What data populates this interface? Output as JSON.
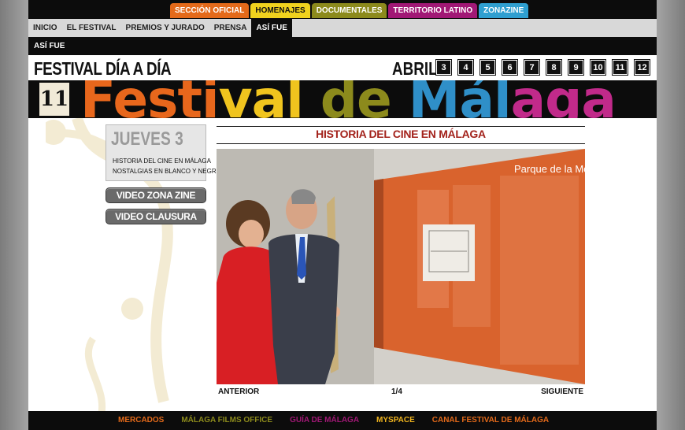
{
  "top_tabs": [
    {
      "label": "SECCIÓN OFICIAL",
      "bg": "#e46a1a",
      "fg": "#ffffff"
    },
    {
      "label": "HOMENAJES",
      "bg": "#f0d21e",
      "fg": "#111111"
    },
    {
      "label": "DOCUMENTALES",
      "bg": "#8c8a1c",
      "fg": "#ffffff"
    },
    {
      "label": "TERRITORIO LATINO",
      "bg": "#a11875",
      "fg": "#ffffff"
    },
    {
      "label": "ZONAZINE",
      "bg": "#2f9fd0",
      "fg": "#ffffff"
    }
  ],
  "nav": {
    "items": [
      "INICIO",
      "EL FESTIVAL",
      "PREMIOS Y JURADO",
      "PRENSA",
      "ASÍ FUE"
    ],
    "active_index": 4
  },
  "subbar": {
    "label": "ASÍ FUE"
  },
  "day_row": {
    "title": "FESTIVAL DÍA A DÍA",
    "month": "ABRIL",
    "days": [
      "3",
      "4",
      "5",
      "6",
      "7",
      "8",
      "9",
      "10",
      "11",
      "12"
    ]
  },
  "banner": {
    "logo": "11",
    "words": [
      {
        "text": "Festi",
        "color": "#e8671c"
      },
      {
        "text": "val",
        "color": "#f0c41e"
      },
      {
        "text": " de ",
        "color": "#8c8a1c"
      },
      {
        "text": "Mál",
        "color": "#2f8fc8"
      },
      {
        "text": "aga",
        "color": "#c12a8a"
      }
    ]
  },
  "day_panel": {
    "heading": "JUEVES 3",
    "links": [
      "HISTORIA DEL CINE EN MÁLAGA",
      "NOSTALGIAS EN BLANCO Y NEGRO"
    ]
  },
  "buttons": {
    "video_zonazine": "VIDEO ZONA ZINE",
    "video_clausura": "VIDEO CLAUSURA"
  },
  "article": {
    "title": "HISTORIA DEL CINE EN MÁLAGA",
    "photo_panel_heading": "Parque de la Merced"
  },
  "pager": {
    "prev": "ANTERIOR",
    "count": "1/4",
    "next": "SIGUIENTE"
  },
  "footer": {
    "links": [
      {
        "label": "MERCADOS",
        "color": "#e46a1a"
      },
      {
        "label": "MÁLAGA FILMS OFFICE",
        "color": "#8c8a1c"
      },
      {
        "label": "GUÍA DE MÁLAGA",
        "color": "#a11875"
      },
      {
        "label": "MYSPACE",
        "color": "#f0b41e"
      },
      {
        "label": "CANAL FESTIVAL DE MÁLAGA",
        "color": "#e46a1a"
      }
    ]
  }
}
